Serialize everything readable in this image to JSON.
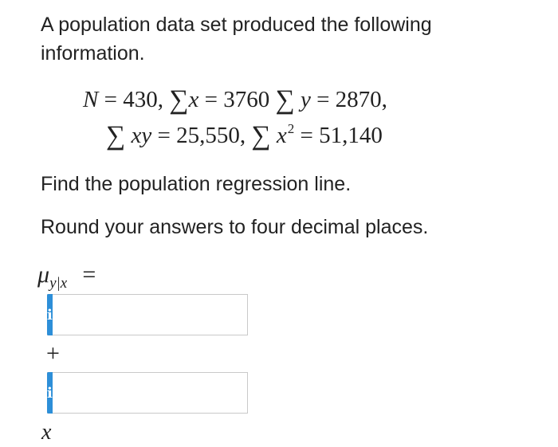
{
  "intro": "A population data set produced the following information.",
  "givens": {
    "N_label": "N",
    "N_value": "430,",
    "sum_x_var": "x",
    "sum_x_value": "3760",
    "sum_y_var": "y",
    "sum_y_value": "2870",
    "sum_xy_var": "xy",
    "sum_xy_value": "25,550,",
    "sum_x2_var": "x",
    "sum_x2_power": "2",
    "sum_x2_value": "51,140",
    "sigma": "∑",
    "equals": "=",
    "comma": ","
  },
  "instruction_find": "Find the population regression line.",
  "instruction_round": "Round your answers to four decimal places.",
  "answer": {
    "mu_symbol": "μ",
    "mu_subscript": "y|x",
    "equals": "=",
    "info_label": "i",
    "intercept_value": "",
    "plus": "+",
    "slope_value": "",
    "x_var": "x"
  },
  "colors": {
    "info_button": "#2d8fd8",
    "input_border": "#c9c9c9",
    "text": "#222222"
  }
}
